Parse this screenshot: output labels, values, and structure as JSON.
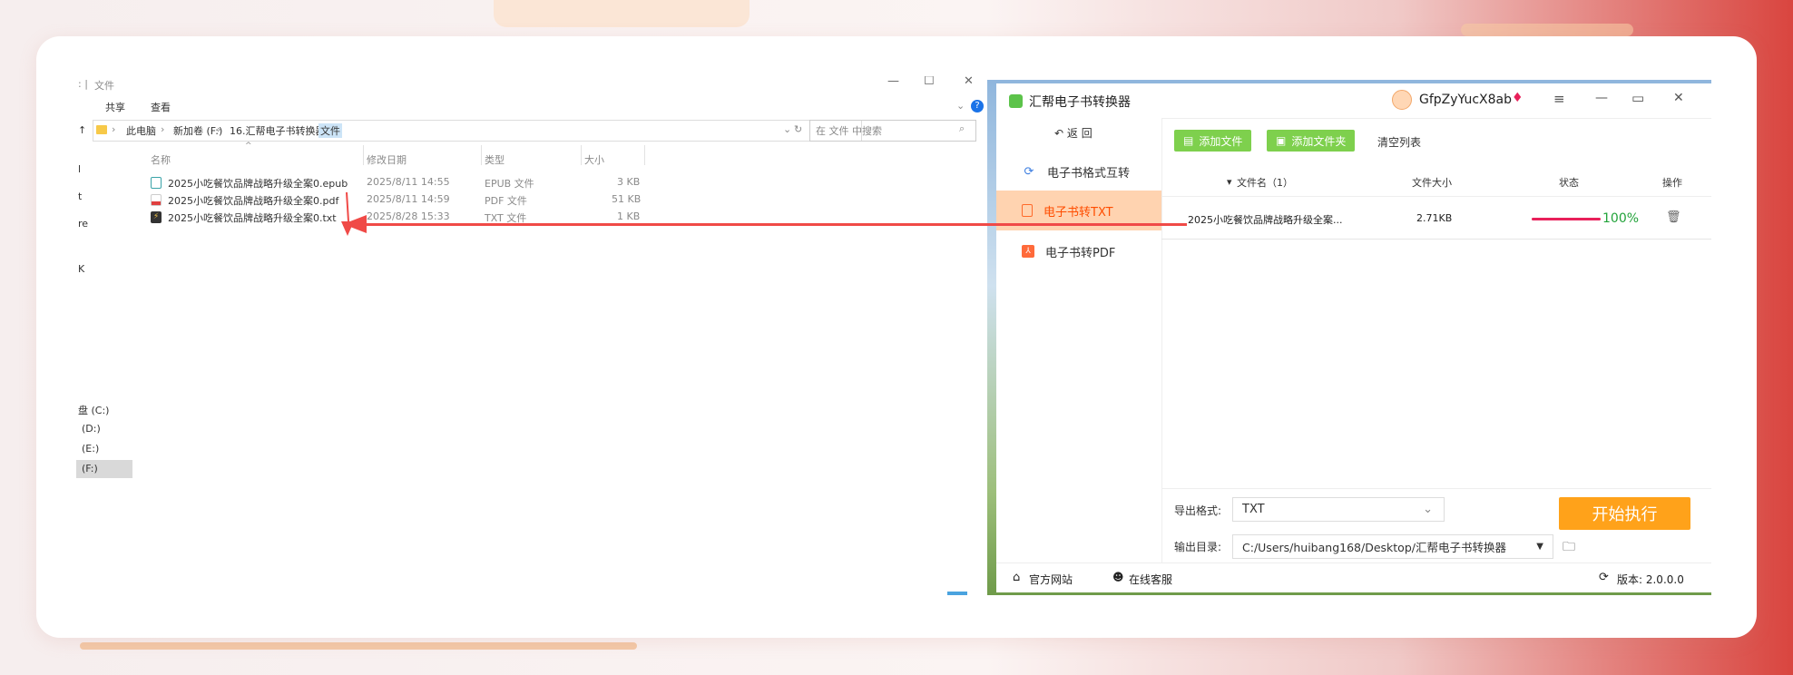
{
  "explorer": {
    "title": "文件",
    "title_prefix": ": |",
    "ribbon": {
      "share": "共享",
      "view": "查看"
    },
    "breadcrumb": [
      "此电脑",
      "新加卷 (F:)",
      "16.汇帮电子书转换器",
      "文件"
    ],
    "search_placeholder": "在 文件 中搜索",
    "columns": {
      "name": "名称",
      "date": "修改日期",
      "type": "类型",
      "size": "大小"
    },
    "files": [
      {
        "name": "2025小吃餐饮品牌战略升级全案0.epub",
        "date": "2025/8/11 14:55",
        "type": "EPUB 文件",
        "size": "3 KB",
        "icon_color": "#3aa3a8"
      },
      {
        "name": "2025小吃餐饮品牌战略升级全案0.pdf",
        "date": "2025/8/11 14:59",
        "type": "PDF 文件",
        "size": "51 KB",
        "icon_color": "#e04040"
      },
      {
        "name": "2025小吃餐饮品牌战略升级全案0.txt",
        "date": "2025/8/28 15:33",
        "type": "TXT 文件",
        "size": "1 KB",
        "icon_color": "#333333"
      }
    ],
    "left_partial": [
      "l",
      "t",
      "re",
      "K"
    ],
    "drives": [
      "盘 (C:)",
      "(D:)",
      "(E:)",
      "(F:)"
    ]
  },
  "app": {
    "title": "汇帮电子书转换器",
    "username": "GfpZyYucX8ab",
    "back": "返    回",
    "menu": [
      {
        "label": "电子书格式互转",
        "icon": "refresh-icon",
        "active": false
      },
      {
        "label": "电子书转TXT",
        "icon": "document-icon",
        "active": true
      },
      {
        "label": "电子书转PDF",
        "icon": "pdf-icon",
        "active": false
      }
    ],
    "toolbar": {
      "add_file": "添加文件",
      "add_folder": "添加文件夹",
      "clear": "清空列表"
    },
    "table": {
      "col_name": "文件名（1）",
      "col_size": "文件大小",
      "col_status": "状态",
      "col_action": "操作",
      "rows": [
        {
          "name": "2025小吃餐饮品牌战略升级全案...",
          "size": "2.71KB",
          "progress": 1.0,
          "progress_label": "100%"
        }
      ]
    },
    "export_format_label": "导出格式:",
    "export_format_value": "TXT",
    "output_dir_label": "输出目录:",
    "output_dir_value": "C:/Users/huibang168/Desktop/汇帮电子书转换器",
    "start_button": "开始执行",
    "footer": {
      "website": "官方网站",
      "service": "在线客服",
      "version": "版本: 2.0.0.0"
    },
    "colors": {
      "accent": "#ff4d00",
      "green": "#7ed04d",
      "orange": "#ffa21a",
      "progress": "#e8205a"
    }
  }
}
